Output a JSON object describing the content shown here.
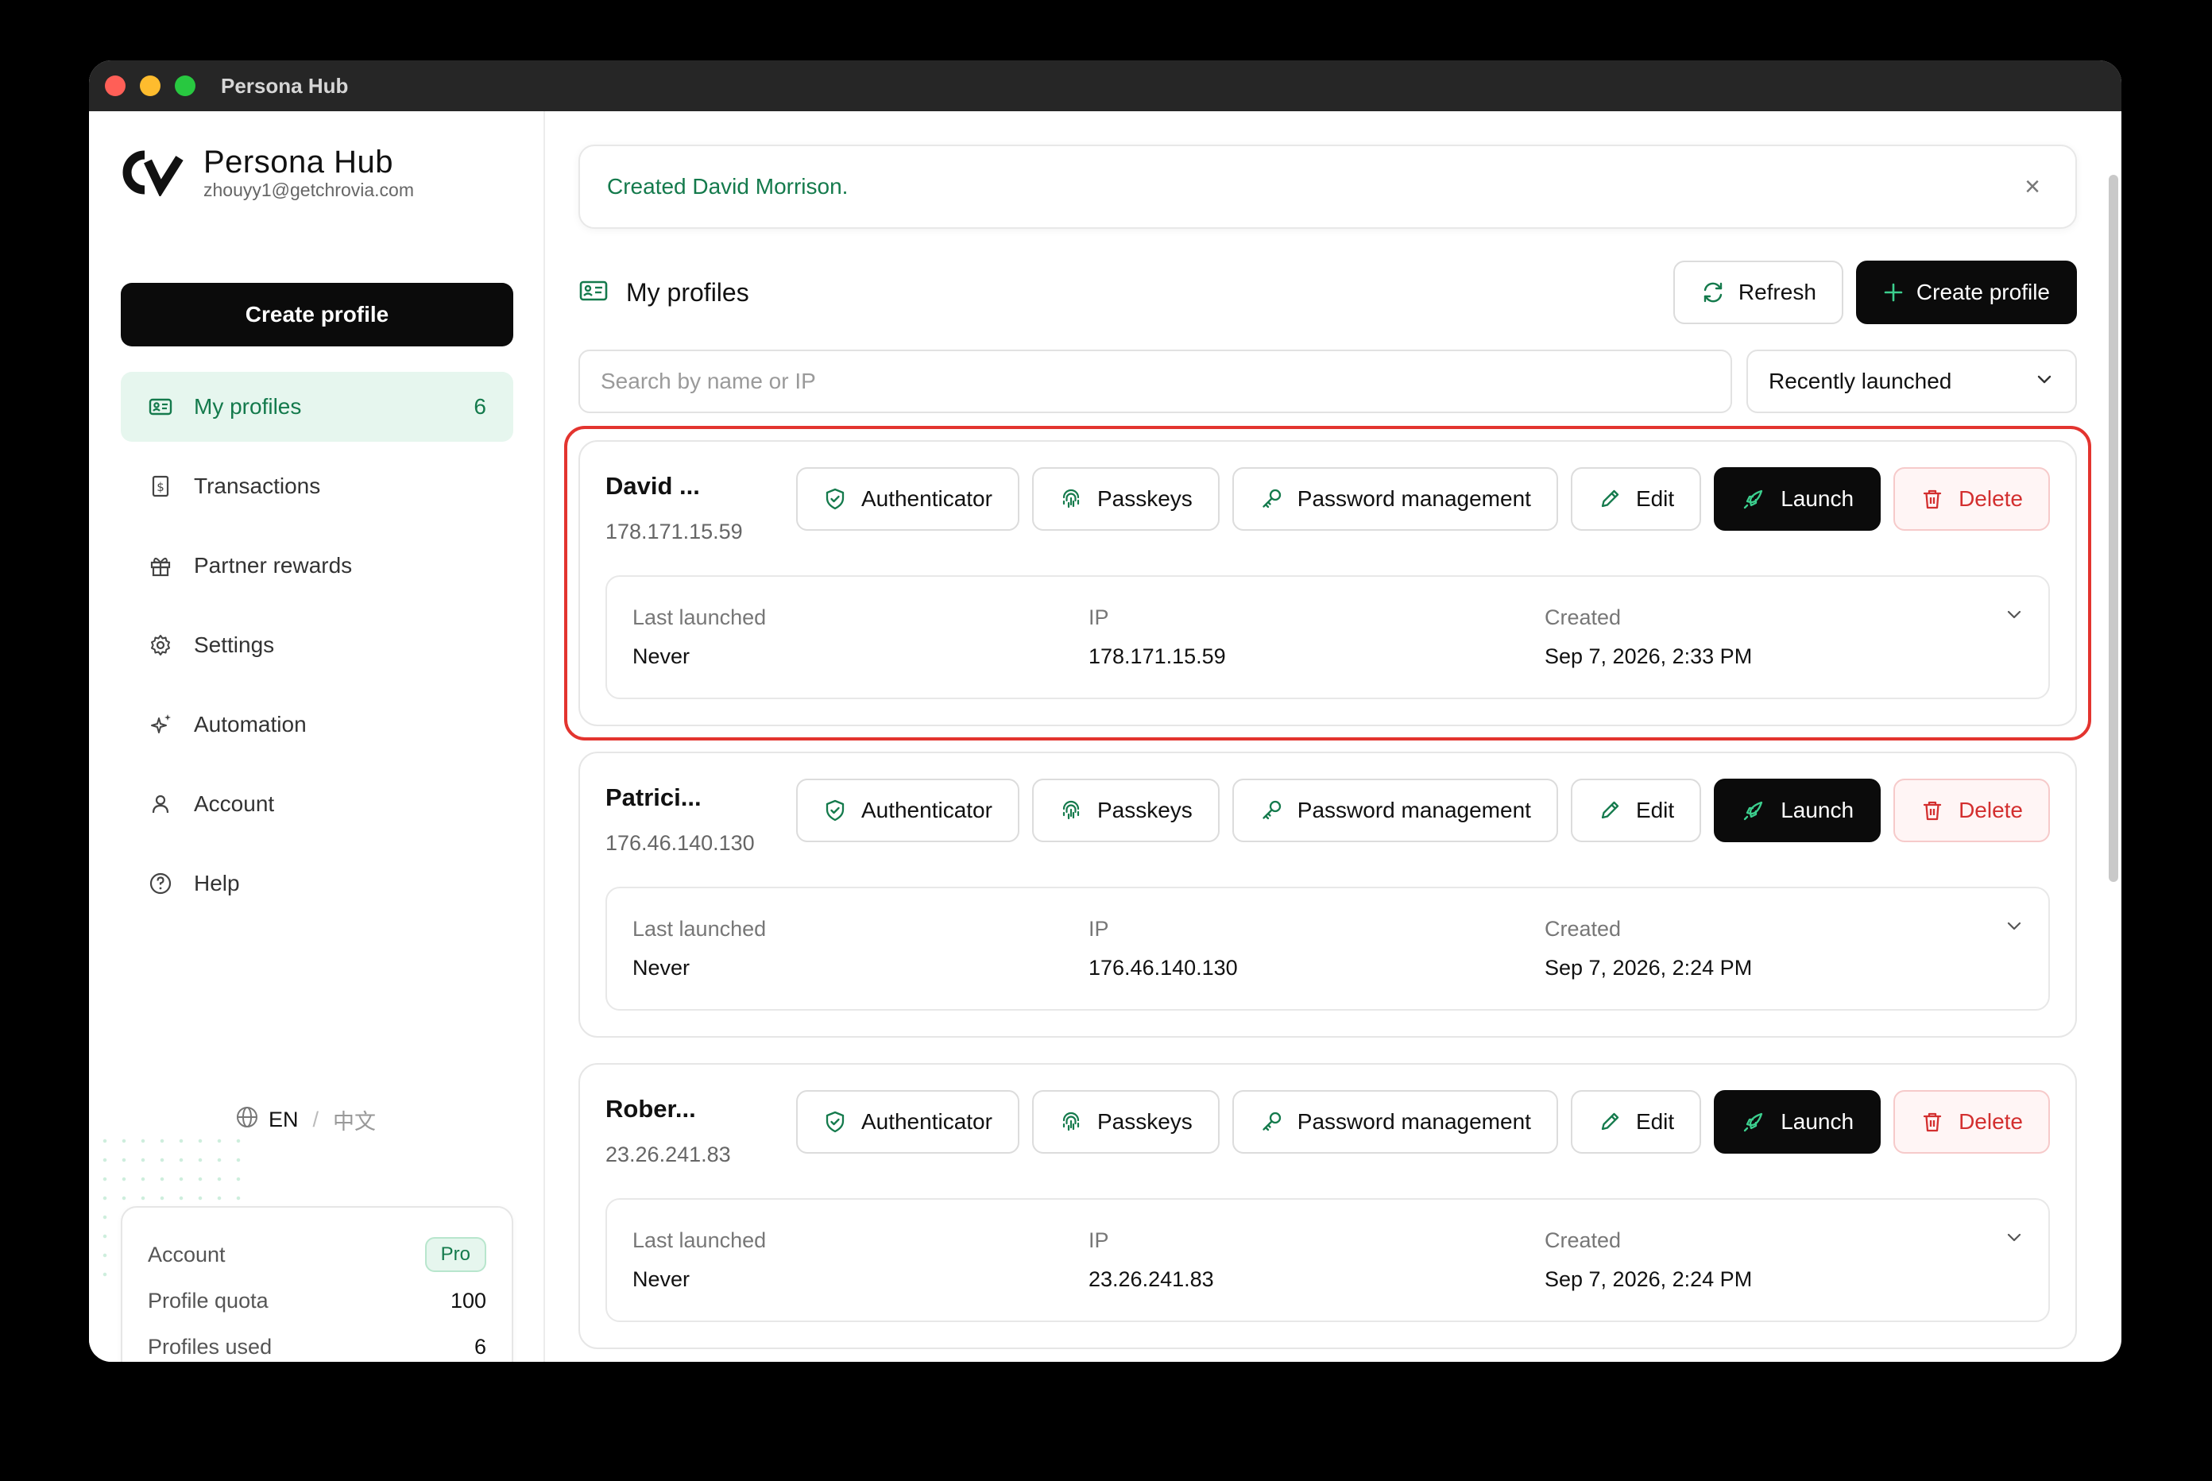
{
  "window": {
    "title": "Persona Hub"
  },
  "brand": {
    "name": "Persona Hub",
    "email": "zhouyy1@getchrovia.com"
  },
  "sidebar": {
    "create_label": "Create profile",
    "items": [
      {
        "label": "My profiles",
        "count": "6",
        "icon": "id-card-icon",
        "active": true
      },
      {
        "label": "Transactions",
        "icon": "receipt-icon"
      },
      {
        "label": "Partner rewards",
        "icon": "gift-icon"
      },
      {
        "label": "Settings",
        "icon": "gear-icon"
      },
      {
        "label": "Automation",
        "icon": "sparkles-icon"
      },
      {
        "label": "Account",
        "icon": "user-icon"
      },
      {
        "label": "Help",
        "icon": "help-circle-icon"
      }
    ],
    "language": {
      "current": "EN",
      "separator": "/",
      "other": "中文"
    },
    "account_card": {
      "account_label": "Account",
      "plan": "Pro",
      "quota_label": "Profile quota",
      "quota_value": "100",
      "used_label": "Profiles used",
      "used_value": "6"
    }
  },
  "toast": {
    "message": "Created David Morrison.",
    "close_glyph": "×"
  },
  "header": {
    "title": "My profiles",
    "refresh_label": "Refresh",
    "create_label": "Create profile"
  },
  "search": {
    "placeholder": "Search by name or IP",
    "value": ""
  },
  "sort": {
    "selected": "Recently launched"
  },
  "card_labels": {
    "authenticator": "Authenticator",
    "passkeys": "Passkeys",
    "password": "Password management",
    "edit": "Edit",
    "launch": "Launch",
    "delete": "Delete",
    "last_launched": "Last launched",
    "ip": "IP",
    "created": "Created"
  },
  "profiles": [
    {
      "name": "David ...",
      "ip": "178.171.15.59",
      "last_launched": "Never",
      "ip_value": "178.171.15.59",
      "created": "Sep 7, 2026, 2:33 PM"
    },
    {
      "name": "Patrici...",
      "ip": "176.46.140.130",
      "last_launched": "Never",
      "ip_value": "176.46.140.130",
      "created": "Sep 7, 2026, 2:24 PM"
    },
    {
      "name": "Rober...",
      "ip": "23.26.241.83",
      "last_launched": "Never",
      "ip_value": "23.26.241.83",
      "created": "Sep 7, 2026, 2:24 PM"
    }
  ],
  "colors": {
    "accent_green": "#147a4c",
    "active_bg": "#e6f6ee",
    "delete_red": "#d32f2f",
    "highlight_red": "#e3342f",
    "dark_button": "#0b0b0b"
  }
}
